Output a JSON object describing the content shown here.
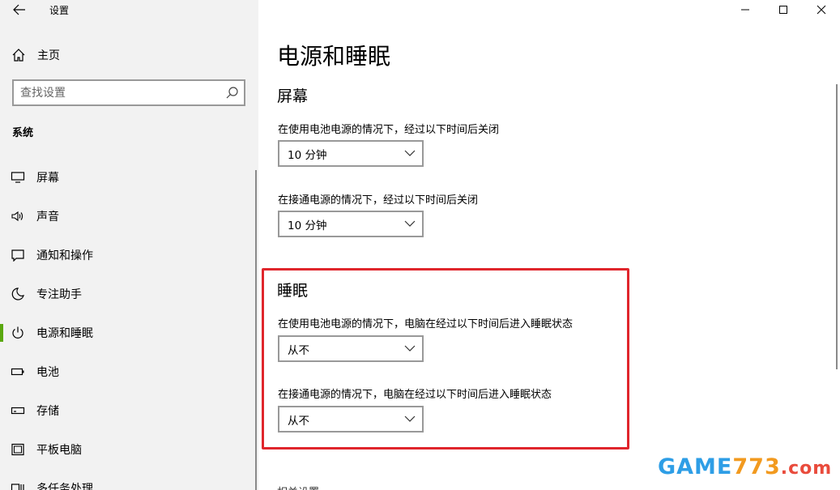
{
  "window": {
    "title": "设置"
  },
  "sidebar": {
    "home_label": "主页",
    "search_placeholder": "查找设置",
    "section_label": "系统",
    "items": [
      {
        "label": "屏幕",
        "icon": "monitor-icon"
      },
      {
        "label": "声音",
        "icon": "speaker-icon"
      },
      {
        "label": "通知和操作",
        "icon": "notification-icon"
      },
      {
        "label": "专注助手",
        "icon": "moon-icon"
      },
      {
        "label": "电源和睡眠",
        "icon": "power-icon",
        "active": true
      },
      {
        "label": "电池",
        "icon": "battery-icon"
      },
      {
        "label": "存储",
        "icon": "storage-icon"
      },
      {
        "label": "平板电脑",
        "icon": "tablet-icon"
      },
      {
        "label": "多任务处理",
        "icon": "multitask-icon"
      }
    ]
  },
  "main": {
    "page_title": "电源和睡眠",
    "screen": {
      "title": "屏幕",
      "battery_label": "在使用电池电源的情况下，经过以下时间后关闭",
      "battery_value": "10 分钟",
      "plugged_label": "在接通电源的情况下，经过以下时间后关闭",
      "plugged_value": "10 分钟"
    },
    "sleep": {
      "title": "睡眠",
      "battery_label": "在使用电池电源的情况下，电脑在经过以下时间后进入睡眠状态",
      "battery_value": "从不",
      "plugged_label": "在接通电源的情况下，电脑在经过以下时间后进入睡眠状态",
      "plugged_value": "从不"
    },
    "cut_off_text": "相关设置"
  },
  "watermark": {
    "part1": "GAME",
    "part2": "773",
    "part3": ".com"
  },
  "colors": {
    "sidebar_bg": "#f2f2f2",
    "active_indicator": "#5aa80f",
    "highlight_border": "#e0262c"
  }
}
